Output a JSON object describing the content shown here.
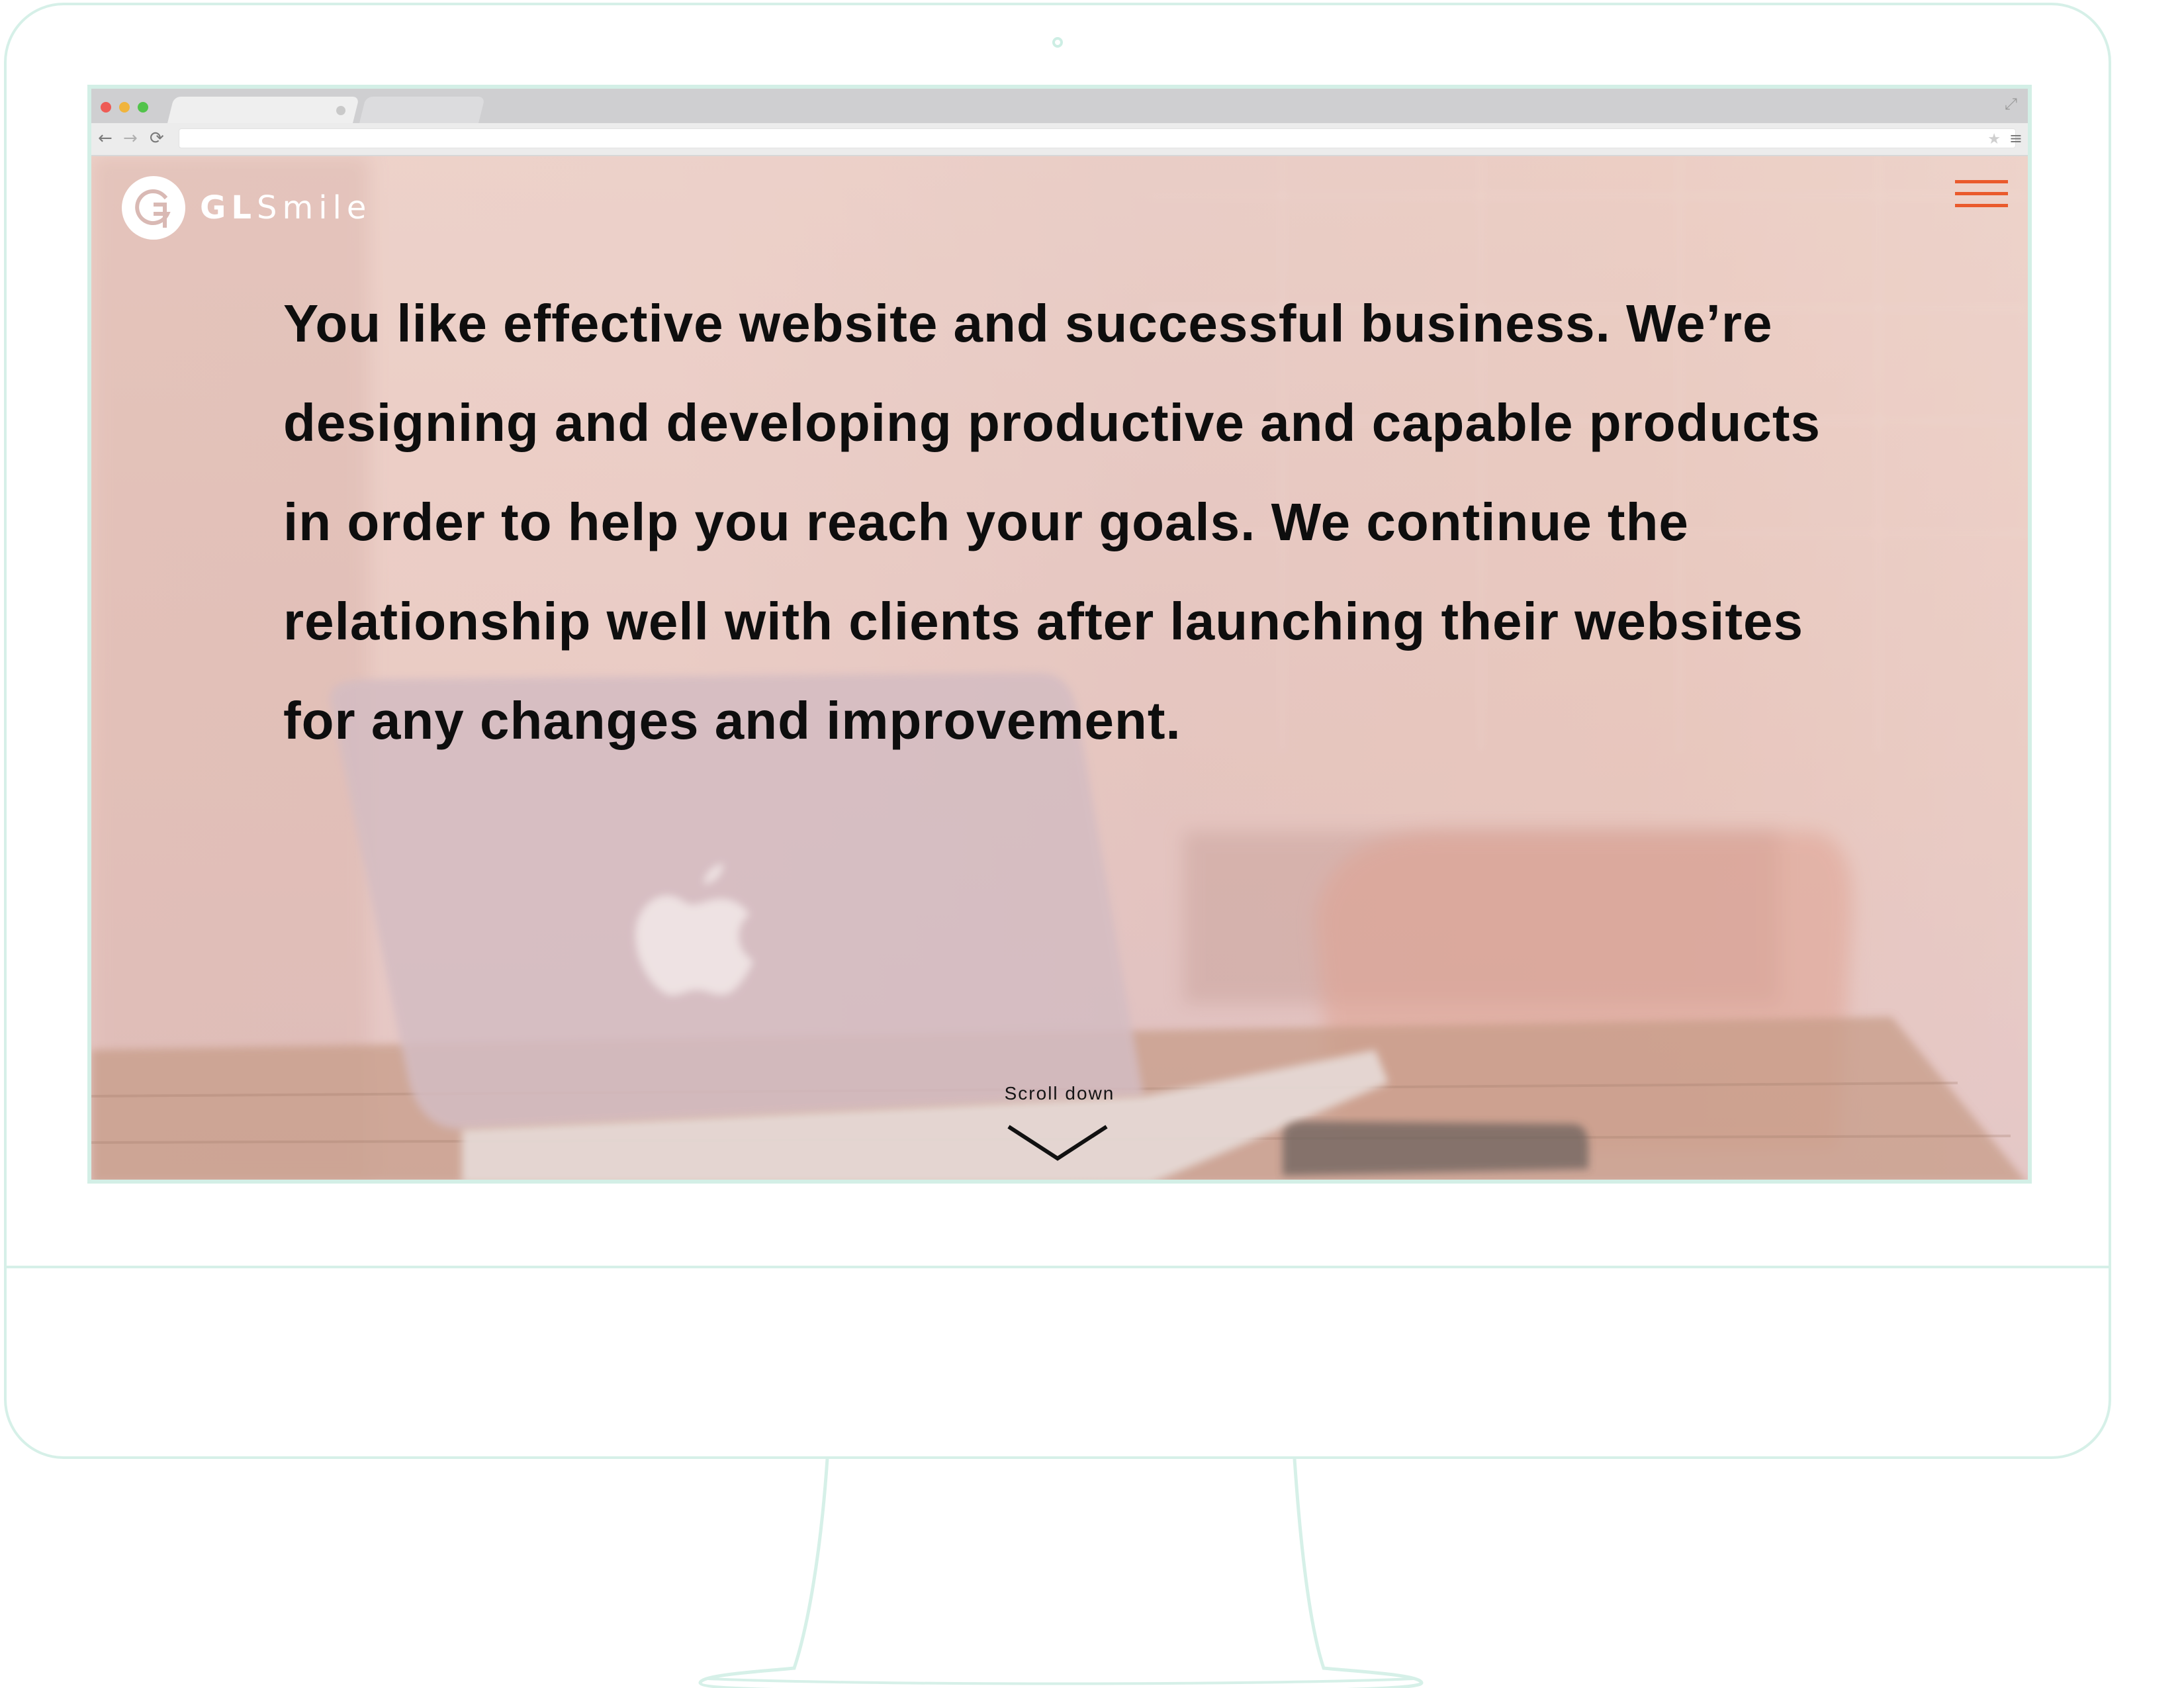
{
  "page": {
    "title": "GLSmile website shown on a desktop monitor mockup"
  },
  "browser": {
    "nav_back": "←",
    "nav_forward": "→",
    "nav_reload": "⟳",
    "bookmark_icon": "star-icon",
    "menu_icon": "≡",
    "expand_icon": "⤢"
  },
  "site": {
    "logo_mark": "G",
    "logo_bold": "GL",
    "logo_light": "Smile",
    "menu_icon_color": "#ea5a2c",
    "headline": "You like effective website and successful business. We’re designing and developing productive and capable products in order to help you reach your goals. We continue the relationship well with clients after launching their websites for any changes and improvement.",
    "scroll_label": "Scroll down"
  },
  "colors": {
    "monitor_outline": "#d6f0e8",
    "accent": "#ea5a2c",
    "headline": "#0e0e0e"
  }
}
